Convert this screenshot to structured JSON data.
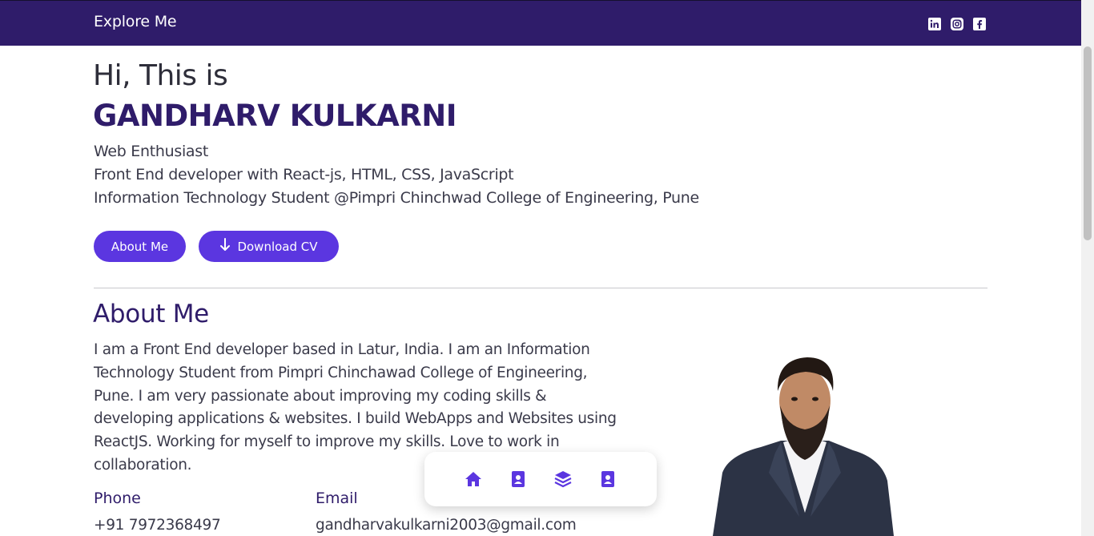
{
  "navbar": {
    "brand": "Explore Me",
    "socials": [
      "linkedin-icon",
      "instagram-icon",
      "facebook-icon"
    ]
  },
  "hero": {
    "greeting": "Hi, This is",
    "name": "GANDHARV KULKARNI",
    "lines": [
      "Web Enthusiast",
      "Front End developer with React-js, HTML, CSS, JavaScript",
      "Information Technology Student @Pimpri Chinchwad College of Engineering, Pune"
    ],
    "about_button": "About Me",
    "cv_button": "Download CV"
  },
  "about": {
    "title": "About Me",
    "text": "I am a Front End developer based in Latur, India. I am an Information Technology Student from Pimpri Chinchawad College of Engineering, Pune. I am very passionate about improving my coding skills & developing applications & websites. I build WebApps and Websites using ReactJS. Working for myself to improve my skills. Love to work in collaboration.",
    "phone_label": "Phone",
    "phone": "+91 7972368497",
    "email_label": "Email",
    "email": "gandharvakulkarni2003@gmail.com"
  },
  "dock": {
    "items": [
      "home-icon",
      "contact-book-icon",
      "layers-icon",
      "contact-book-icon"
    ]
  },
  "colors": {
    "navbar": "#2f1c6a",
    "accent": "#5b36e0",
    "heading": "#2f1c6a"
  }
}
